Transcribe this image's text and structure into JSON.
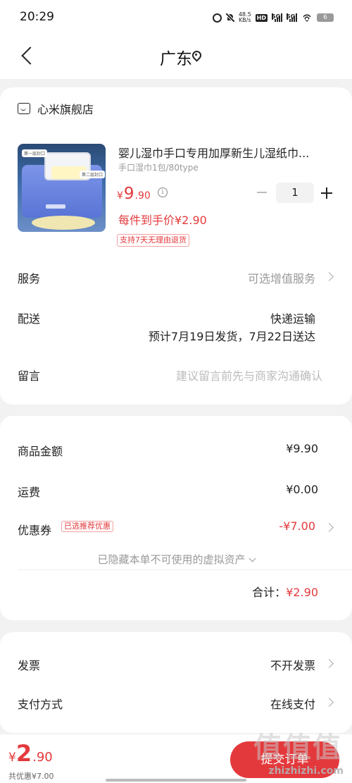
{
  "status_bar": {
    "time": "20:29",
    "net_speed_top": "48.5",
    "net_speed_bottom": "KB/s",
    "hd_label": "HD",
    "sig1_label": "5G",
    "sig2_label": "5G",
    "battery": "6"
  },
  "nav": {
    "title": "广东"
  },
  "shop": {
    "name": "心米旗舰店"
  },
  "product": {
    "title": "婴儿湿巾手口专用加厚新生儿湿纸巾...",
    "spec": "手口湿巾1包/80type",
    "price_currency": "¥",
    "price_int": "9",
    "price_dec": ".90",
    "quantity": "1",
    "unit_price": "每件到手价¥2.90",
    "return_tag": "支持7天无理由退货",
    "image_tag_a": "第一层封口",
    "image_tag_b": "第二层封口"
  },
  "rows": {
    "service_label": "服务",
    "service_value": "可选增值服务",
    "delivery_label": "配送",
    "delivery_method": "快递运输",
    "delivery_date": "预计7月19日发货，7月22日送达",
    "message_label": "留言",
    "message_placeholder": "建议留言前先与商家沟通确认"
  },
  "summary": {
    "goods_label": "商品金额",
    "goods_value": "¥9.90",
    "freight_label": "运费",
    "freight_value": "¥0.00",
    "coupon_label": "优惠券",
    "coupon_tag": "已选推荐优惠",
    "coupon_value": "-¥7.00",
    "hidden_assets": "已隐藏本单不可使用的虚拟资产",
    "total_label": "合计：",
    "total_value": "¥2.90"
  },
  "invoice": {
    "invoice_label": "发票",
    "invoice_value": "不开发票",
    "payment_label": "支付方式",
    "payment_value": "在线支付"
  },
  "bottom": {
    "pay_currency": "¥",
    "pay_int": "2",
    "pay_dec": ".90",
    "discount": "共优惠¥7.00",
    "submit": "提交订单"
  },
  "watermark": {
    "glyphs": "值值值",
    "url": "zhizhizhi.com"
  },
  "colors": {
    "accent": "#e4393c",
    "background": "#f2f2f2"
  }
}
